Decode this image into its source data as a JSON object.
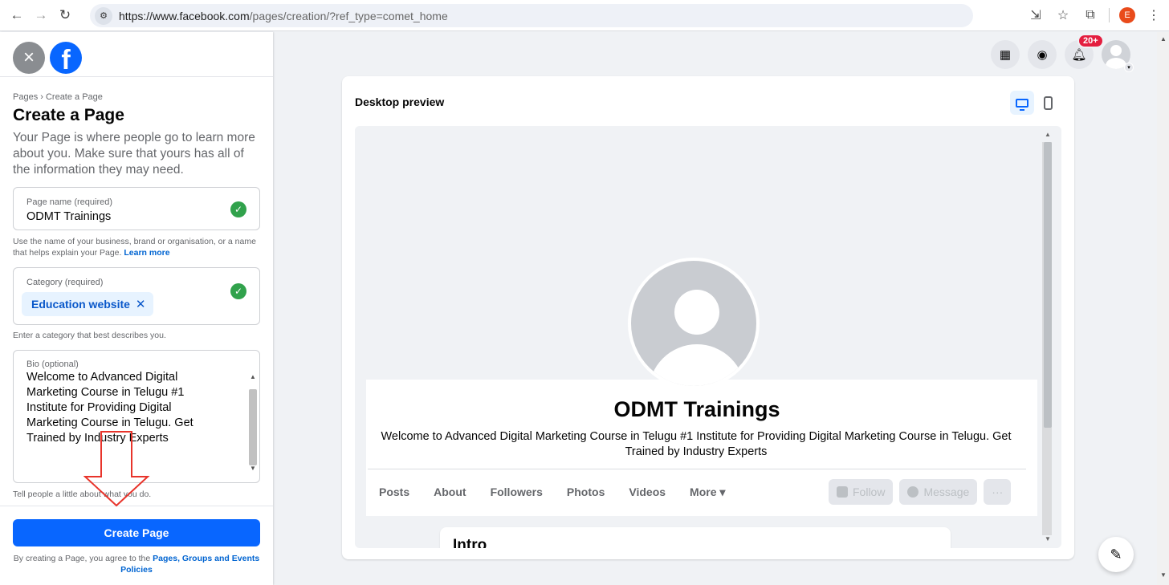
{
  "browser": {
    "url_host": "https://www.facebook.com",
    "url_path": "/pages/creation/?ref_type=comet_home",
    "profile_initial": "E"
  },
  "left": {
    "breadcrumb": "Pages › Create a Page",
    "title": "Create a Page",
    "intro": "Your Page is where people go to learn more about you. Make sure that yours has all of the information they may need.",
    "page_name": {
      "label": "Page name (required)",
      "value": "ODMT Trainings",
      "helper": "Use the name of your business, brand or organisation, or a name that helps explain your Page.",
      "helper_link": "Learn more"
    },
    "category": {
      "label": "Category (required)",
      "chip": "Education website",
      "helper": "Enter a category that best describes you."
    },
    "bio": {
      "label": "Bio (optional)",
      "value": "Welcome to Advanced Digital Marketing Course in Telugu #1 Institute for Providing  Digital Marketing Course in Telugu. Get Trained by Industry Experts",
      "helper": "Tell people a little about what you do."
    },
    "create_button": "Create Page",
    "terms_prefix": "By creating a Page, you agree to the",
    "terms_link": "Pages, Groups and Events Policies"
  },
  "top_nav": {
    "notification_badge": "20+"
  },
  "preview": {
    "title": "Desktop preview",
    "page_name": "ODMT Trainings",
    "page_bio": "Welcome to Advanced Digital Marketing Course in Telugu #1 Institute for Providing Digital Marketing Course in Telugu. Get Trained by Industry Experts",
    "tabs": [
      "Posts",
      "About",
      "Followers",
      "Photos",
      "Videos",
      "More ▾"
    ],
    "follow_button": "Follow",
    "message_button": "Message",
    "more_button": "···",
    "intro_heading": "Intro"
  },
  "colors": {
    "facebook_blue": "#0866ff",
    "success_green": "#31a24c",
    "annotation_red": "#e8342b"
  }
}
